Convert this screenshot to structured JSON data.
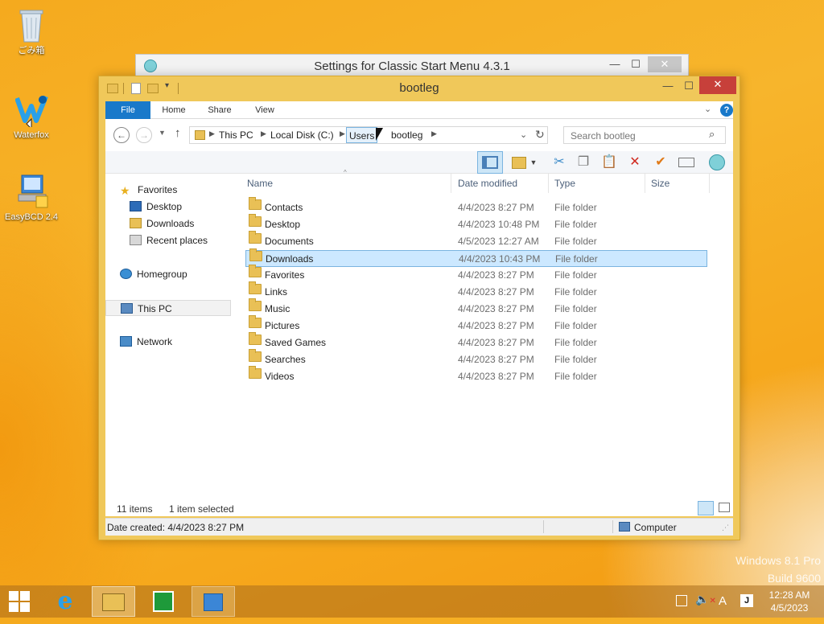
{
  "desktop": {
    "icons": [
      {
        "label": "ごみ箱"
      },
      {
        "label": "Waterfox"
      },
      {
        "label": "EasyBCD 2.4"
      }
    ],
    "watermark": {
      "line1": "Windows 8.1 Pro",
      "line2": "Build 9600"
    }
  },
  "bg_window": {
    "title": "Settings for Classic Start Menu 4.3.1"
  },
  "window": {
    "title": "bootleg",
    "ribbon": {
      "file": "File",
      "home": "Home",
      "share": "Share",
      "view": "View"
    },
    "breadcrumb": [
      "This PC",
      "Local Disk (C:)",
      "Users",
      "bootleg"
    ],
    "search_placeholder": "Search bootleg",
    "nav": {
      "favorites": "Favorites",
      "desktop": "Desktop",
      "downloads": "Downloads",
      "recent": "Recent places",
      "homegroup": "Homegroup",
      "thispc": "This PC",
      "network": "Network"
    },
    "columns": {
      "name": "Name",
      "date": "Date modified",
      "type": "Type",
      "size": "Size"
    },
    "files": [
      {
        "name": "Contacts",
        "date": "4/4/2023 8:27 PM",
        "type": "File folder"
      },
      {
        "name": "Desktop",
        "date": "4/4/2023 10:48 PM",
        "type": "File folder"
      },
      {
        "name": "Documents",
        "date": "4/5/2023 12:27 AM",
        "type": "File folder"
      },
      {
        "name": "Downloads",
        "date": "4/4/2023 10:43 PM",
        "type": "File folder"
      },
      {
        "name": "Favorites",
        "date": "4/4/2023 8:27 PM",
        "type": "File folder"
      },
      {
        "name": "Links",
        "date": "4/4/2023 8:27 PM",
        "type": "File folder"
      },
      {
        "name": "Music",
        "date": "4/4/2023 8:27 PM",
        "type": "File folder"
      },
      {
        "name": "Pictures",
        "date": "4/4/2023 8:27 PM",
        "type": "File folder"
      },
      {
        "name": "Saved Games",
        "date": "4/4/2023 8:27 PM",
        "type": "File folder"
      },
      {
        "name": "Searches",
        "date": "4/4/2023 8:27 PM",
        "type": "File folder"
      },
      {
        "name": "Videos",
        "date": "4/4/2023 8:27 PM",
        "type": "File folder"
      }
    ],
    "selected_index": 3,
    "status": {
      "count": "11 items",
      "selected": "1 item selected",
      "date_created": "Date created: 4/4/2023 8:27 PM",
      "location": "Computer"
    }
  },
  "taskbar": {
    "time": "12:28 AM",
    "date": "4/5/2023",
    "ime": "A"
  }
}
